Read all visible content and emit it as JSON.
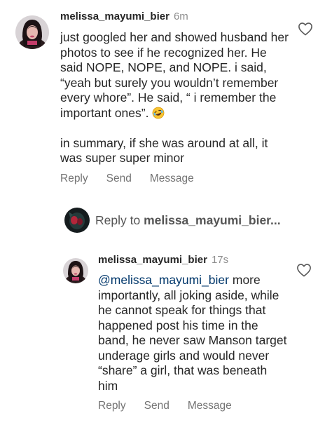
{
  "comments": [
    {
      "username": "melissa_mayumi_bier",
      "time": "6m",
      "paragraphs": [
        "just googled her and showed husband her photos to see if he recognized her. He said NOPE, NOPE, and NOPE. i said, “yeah but surely you wouldn’t remember every whore”. He said, “ i remember the important ones”.",
        "in summary, if she was around at all, it was super super minor"
      ],
      "emoji": "🤣",
      "actions": {
        "reply": "Reply",
        "send": "Send",
        "message": "Message"
      }
    }
  ],
  "reply_bar": {
    "prefix": "Reply to",
    "target": "melissa_mayumi_bier..."
  },
  "reply": {
    "username": "melissa_mayumi_bier",
    "time": "17s",
    "mention": "@melissa_mayumi_bier",
    "text": " more importantly, all joking aside, while he cannot speak for things that happened post his time in the band, he never saw Manson target underage girls and would never “share” a girl, that was beneath him",
    "actions": {
      "reply": "Reply",
      "send": "Send",
      "message": "Message"
    }
  },
  "icons": {
    "heart": "heart-outline-icon",
    "emoji": "rolling-on-floor-laughing-emoji"
  },
  "colors": {
    "text": "#262626",
    "muted": "#737373",
    "mention": "#00376b"
  }
}
